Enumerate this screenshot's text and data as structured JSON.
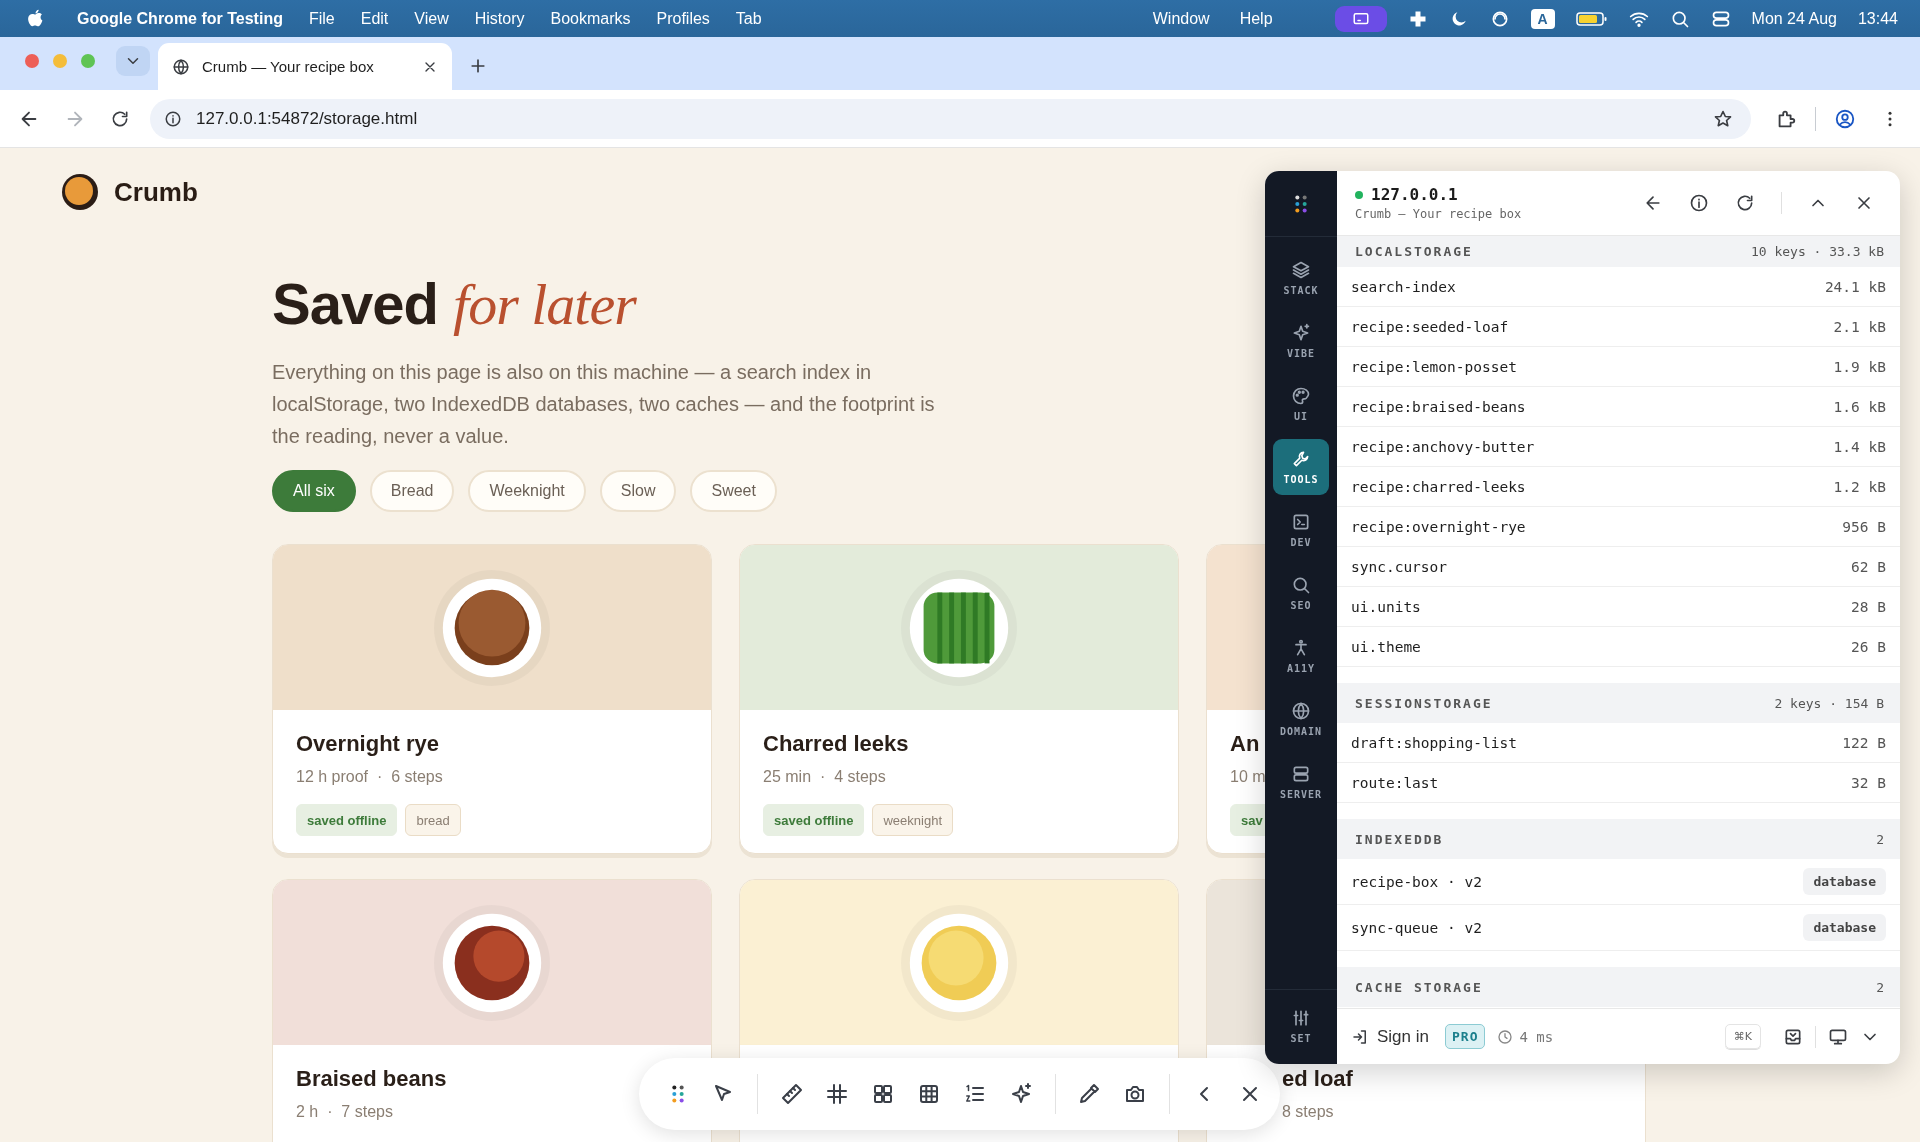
{
  "menubar": {
    "app": "Google Chrome for Testing",
    "menus": [
      "File",
      "Edit",
      "View",
      "History",
      "Bookmarks",
      "Profiles",
      "Tab"
    ],
    "menus_right": [
      "Window",
      "Help"
    ],
    "input_source": "A",
    "date": "Mon 24 Aug",
    "time": "13:44"
  },
  "browser": {
    "tab": {
      "title": "Crumb — Your recipe box"
    },
    "url": "127.0.0.1:54872/storage.html"
  },
  "site": {
    "name": "Crumb"
  },
  "hero": {
    "title": "Saved",
    "accent": "for later",
    "body": "Everything on this page is also on this machine — a search index in localStorage, two IndexedDB databases, two caches — and the footprint is the reading, never a value."
  },
  "filters": [
    {
      "label": "All six",
      "selected": true
    },
    {
      "label": "Bread",
      "selected": false
    },
    {
      "label": "Weeknight",
      "selected": false
    },
    {
      "label": "Slow",
      "selected": false
    },
    {
      "label": "Sweet",
      "selected": false
    }
  ],
  "cards": [
    {
      "title": "Overnight rye",
      "meta": "12 h proof  ·  6 steps",
      "tags": [
        {
          "label": "saved offline",
          "kind": "offline"
        },
        {
          "label": "bread",
          "kind": "plain"
        }
      ],
      "color": "#efdfca",
      "kind": "loaf"
    },
    {
      "title": "Charred leeks",
      "meta": "25 min  ·  4 steps",
      "tags": [
        {
          "label": "saved offline",
          "kind": "offline"
        },
        {
          "label": "weeknight",
          "kind": "plain"
        }
      ],
      "color": "#e3ebda",
      "kind": "leeks"
    },
    {
      "title": "An",
      "meta": "10 m",
      "tags": [
        {
          "label": "sav",
          "kind": "offline"
        }
      ],
      "color": "#f4e2cf",
      "kind": "none"
    },
    {
      "title": "Braised beans",
      "meta": "2 h  ·  7 steps",
      "color": "#f1dfd9",
      "kind": "beans"
    },
    {
      "color": "#fbf0d3",
      "kind": "posset"
    },
    {
      "title": "ed loaf",
      "meta": "8 steps",
      "color": "#ebe4da",
      "kind": "none"
    }
  ],
  "devtools": {
    "host": "127.0.0.1",
    "page": "Crumb — Your recipe box",
    "nav": [
      {
        "label": "STACK",
        "selected": false
      },
      {
        "label": "VIBE",
        "selected": false
      },
      {
        "label": "UI",
        "selected": false
      },
      {
        "label": "TOOLS",
        "selected": true
      },
      {
        "label": "DEV",
        "selected": false
      },
      {
        "label": "SEO",
        "selected": false
      },
      {
        "label": "A11Y",
        "selected": false
      },
      {
        "label": "DOMAIN",
        "selected": false
      },
      {
        "label": "SERVER",
        "selected": false
      }
    ],
    "settings": "SET",
    "sections": [
      {
        "title": "LOCALSTORAGE",
        "summary": "10 keys · 33.3 kB",
        "rows": [
          {
            "key": "search-index",
            "value": "24.1 kB",
            "kind": "size"
          },
          {
            "key": "recipe:seeded-loaf",
            "value": "2.1 kB",
            "kind": "size"
          },
          {
            "key": "recipe:lemon-posset",
            "value": "1.9 kB",
            "kind": "size"
          },
          {
            "key": "recipe:braised-beans",
            "value": "1.6 kB",
            "kind": "size"
          },
          {
            "key": "recipe:anchovy-butter",
            "value": "1.4 kB",
            "kind": "size"
          },
          {
            "key": "recipe:charred-leeks",
            "value": "1.2 kB",
            "kind": "size"
          },
          {
            "key": "recipe:overnight-rye",
            "value": "956 B",
            "kind": "size"
          },
          {
            "key": "sync.cursor",
            "value": "62 B",
            "kind": "size"
          },
          {
            "key": "ui.units",
            "value": "28 B",
            "kind": "size"
          },
          {
            "key": "ui.theme",
            "value": "26 B",
            "kind": "size"
          }
        ]
      },
      {
        "title": "SESSIONSTORAGE",
        "summary": "2 keys · 154 B",
        "rows": [
          {
            "key": "draft:shopping-list",
            "value": "122 B",
            "kind": "size"
          },
          {
            "key": "route:last",
            "value": "32 B",
            "kind": "size"
          }
        ]
      },
      {
        "title": "INDEXEDDB",
        "summary": "2",
        "rows": [
          {
            "key": "recipe-box · v2",
            "value": "database",
            "kind": "badge"
          },
          {
            "key": "sync-queue · v2",
            "value": "database",
            "kind": "badge"
          }
        ]
      },
      {
        "title": "CACHE STORAGE",
        "summary": "2"
      }
    ],
    "footer": {
      "sign_in": "Sign in",
      "plan": "PRO",
      "timing": "4 ms",
      "shortcut": "⌘K"
    }
  }
}
